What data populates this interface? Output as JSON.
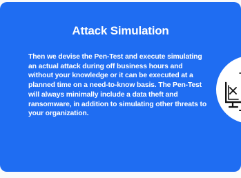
{
  "card": {
    "title": "Attack Simulation",
    "body": "Then we devise the Pen-Test and execute simulating an actual attack during off business hours and without your knowledge or it can be executed at a planned time on a need-to-know basis. The Pen-Test will always minimally include a data theft and ransomware, in addition to simulating other threats to your organization.",
    "icon": "computer-attack-icon",
    "accent_color": "#1f6df2"
  }
}
